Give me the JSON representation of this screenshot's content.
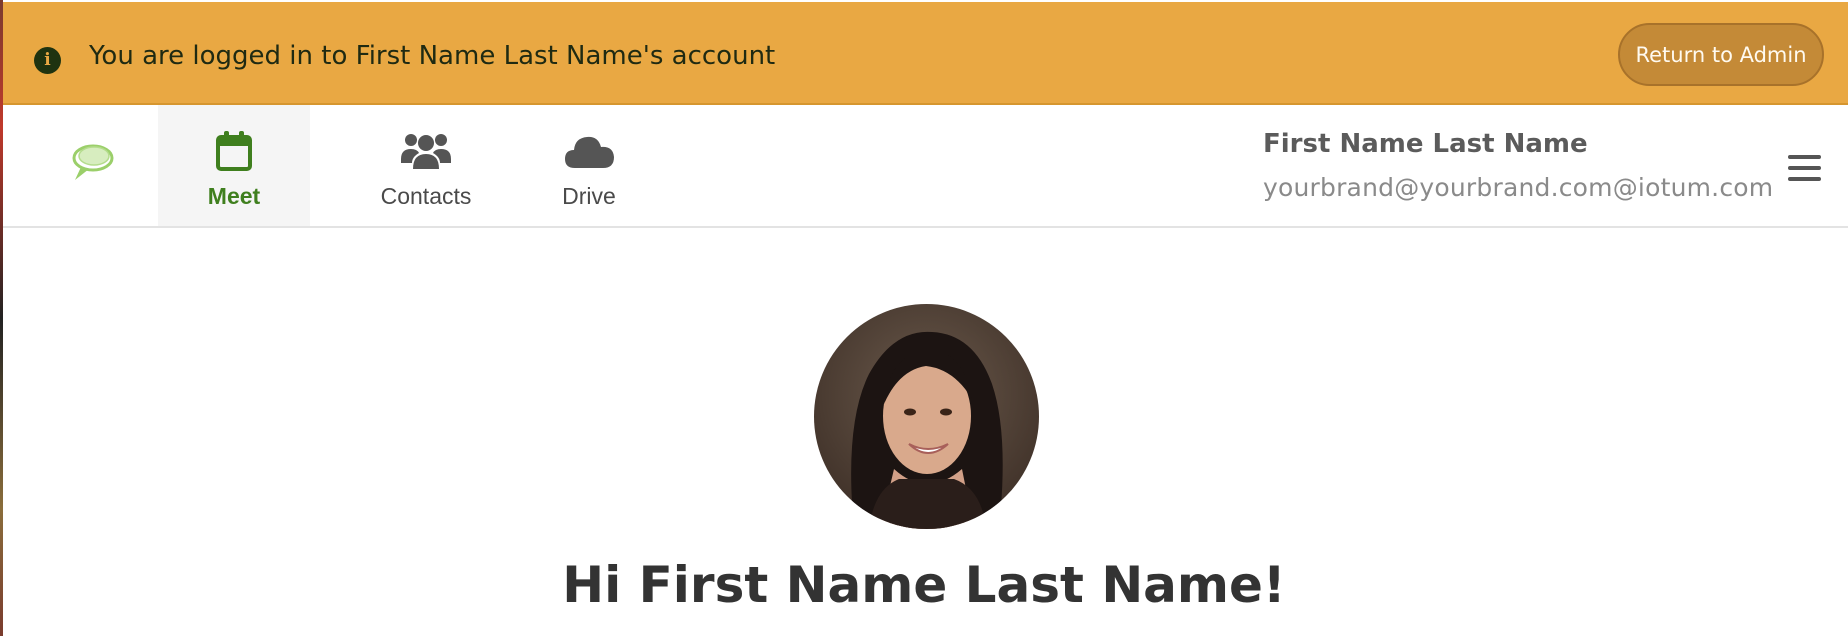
{
  "banner": {
    "message": "You are logged in to First Name Last Name's account",
    "icon": "info-circle-icon",
    "return_label": "Return to Admin",
    "background": "#e9a843"
  },
  "nav": {
    "items": [
      {
        "label": "Meet",
        "icon": "calendar-icon",
        "active": true
      },
      {
        "label": "Contacts",
        "icon": "users-icon",
        "active": false
      },
      {
        "label": "Drive",
        "icon": "cloud-icon",
        "active": false
      }
    ],
    "active_color": "#3f7f1e"
  },
  "user": {
    "name": "First Name Last Name",
    "email": "yourbrand@yourbrand.com@iotum.com"
  },
  "main": {
    "greeting": "Hi First Name Last Name!"
  }
}
